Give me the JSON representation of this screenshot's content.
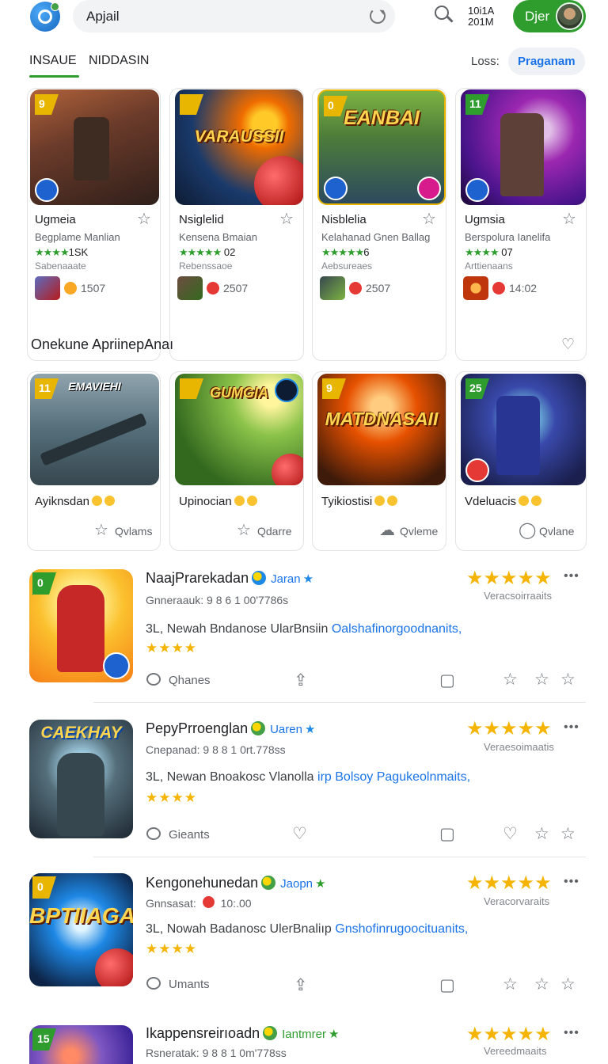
{
  "header": {
    "search_text": "Apjail",
    "status_line1": "10i1A",
    "status_line2": "201M",
    "user_name": "Djer"
  },
  "tabs": [
    {
      "label": "INSAUE",
      "active": true
    },
    {
      "label": "NIDDASIN",
      "active": false
    }
  ],
  "filter": {
    "label": "Loss:",
    "button": "Praganam"
  },
  "featured": [
    {
      "badge": "9",
      "title": "Ugmeia",
      "subtitle": "Begplame Manlian",
      "rating_stars": "★★★★",
      "rating_text": "1SK",
      "tag": "Sabenaaate",
      "count": "1507"
    },
    {
      "badge": "",
      "title": "Nsiglelid",
      "subtitle": "Kensena Bmaian",
      "rating_stars": "★★★★★",
      "rating_text": "02",
      "tag": "Rebenssaoe",
      "count": "2507",
      "art_title": "VARAUSSII"
    },
    {
      "badge": "0",
      "title": "Nisblelia",
      "subtitle": "Kelahanad Gnen Ballag",
      "rating_stars": "★★★★★",
      "rating_text": "6",
      "tag": "Aebsureaes",
      "count": "2507",
      "art_title": "EANBAI"
    },
    {
      "badge": "11",
      "title": "Ugmsia",
      "subtitle": "Berspolura Ianelifa",
      "rating_stars": "★★★★",
      "rating_text": "07",
      "tag": "Arttienaans",
      "count": "14:02"
    }
  ],
  "section_heading": "Onekune ApriinepAnaı",
  "row2": [
    {
      "badge": "11",
      "title": "Ayiknsdan",
      "action": "Qvlams",
      "art_title": "EMAVIEHI"
    },
    {
      "badge": "",
      "title": "Upinocian",
      "action": "Qdarre",
      "art_title": "GUMGIA"
    },
    {
      "badge": "9",
      "title": "Tyikiostisi",
      "action": "Qvleme",
      "art_title": "MATDNASAII"
    },
    {
      "badge": "25",
      "title": "Vdeluacis",
      "action": "Qvlane"
    }
  ],
  "list_items": [
    {
      "badge": "0",
      "title": "NaajPrarekadan",
      "developer": "Jaran",
      "meta": "Gnneraauk:  9 8 6 1 00'7786s",
      "desc_plain": "3L, Newah Bndanose UlarBnsiin ",
      "desc_link": "Oalshafinorgoodnanits,",
      "small_stars": "★★★★",
      "big_stars": "★★★★★",
      "rating_caption": "Veracsoirraaits",
      "action": "Qhanes"
    },
    {
      "badge": "",
      "title": "PepyPrroenglan",
      "developer": "Uaren",
      "meta": "Cnepanad:  9 8 8 1 0rt.778ss",
      "desc_plain": "3L, Newan Bnoakosc Vlanolla ",
      "desc_link": "irp Bolsoy Pagukeolnmaits,",
      "small_stars": "★★★★",
      "big_stars": "★★★★★",
      "rating_caption": "Veraesoimaatis",
      "action": "Gieants",
      "art_title": "CAEKHAY"
    },
    {
      "badge": "0",
      "title": "Kengonehunedan",
      "developer": "Jaopn",
      "meta": "Gnnsasat:",
      "meta_count": "10:.00",
      "desc_plain": "3L, Nowah Badanosc UlerBnaliıp ",
      "desc_link": "Gnshofinrugoocituanits,",
      "small_stars": "★★★★",
      "big_stars": "★★★★★",
      "rating_caption": "Veracorvaraits",
      "action": "Umants",
      "art_title": "BPTIIAGA"
    },
    {
      "badge": "15",
      "title": "Ikappensreirıoadn",
      "developer": "Iantmrer",
      "meta": "Rsneratak:  9 8 8 1 0m'778ss",
      "big_stars": "★★★★★",
      "rating_caption": "Vereedmaaits"
    }
  ]
}
